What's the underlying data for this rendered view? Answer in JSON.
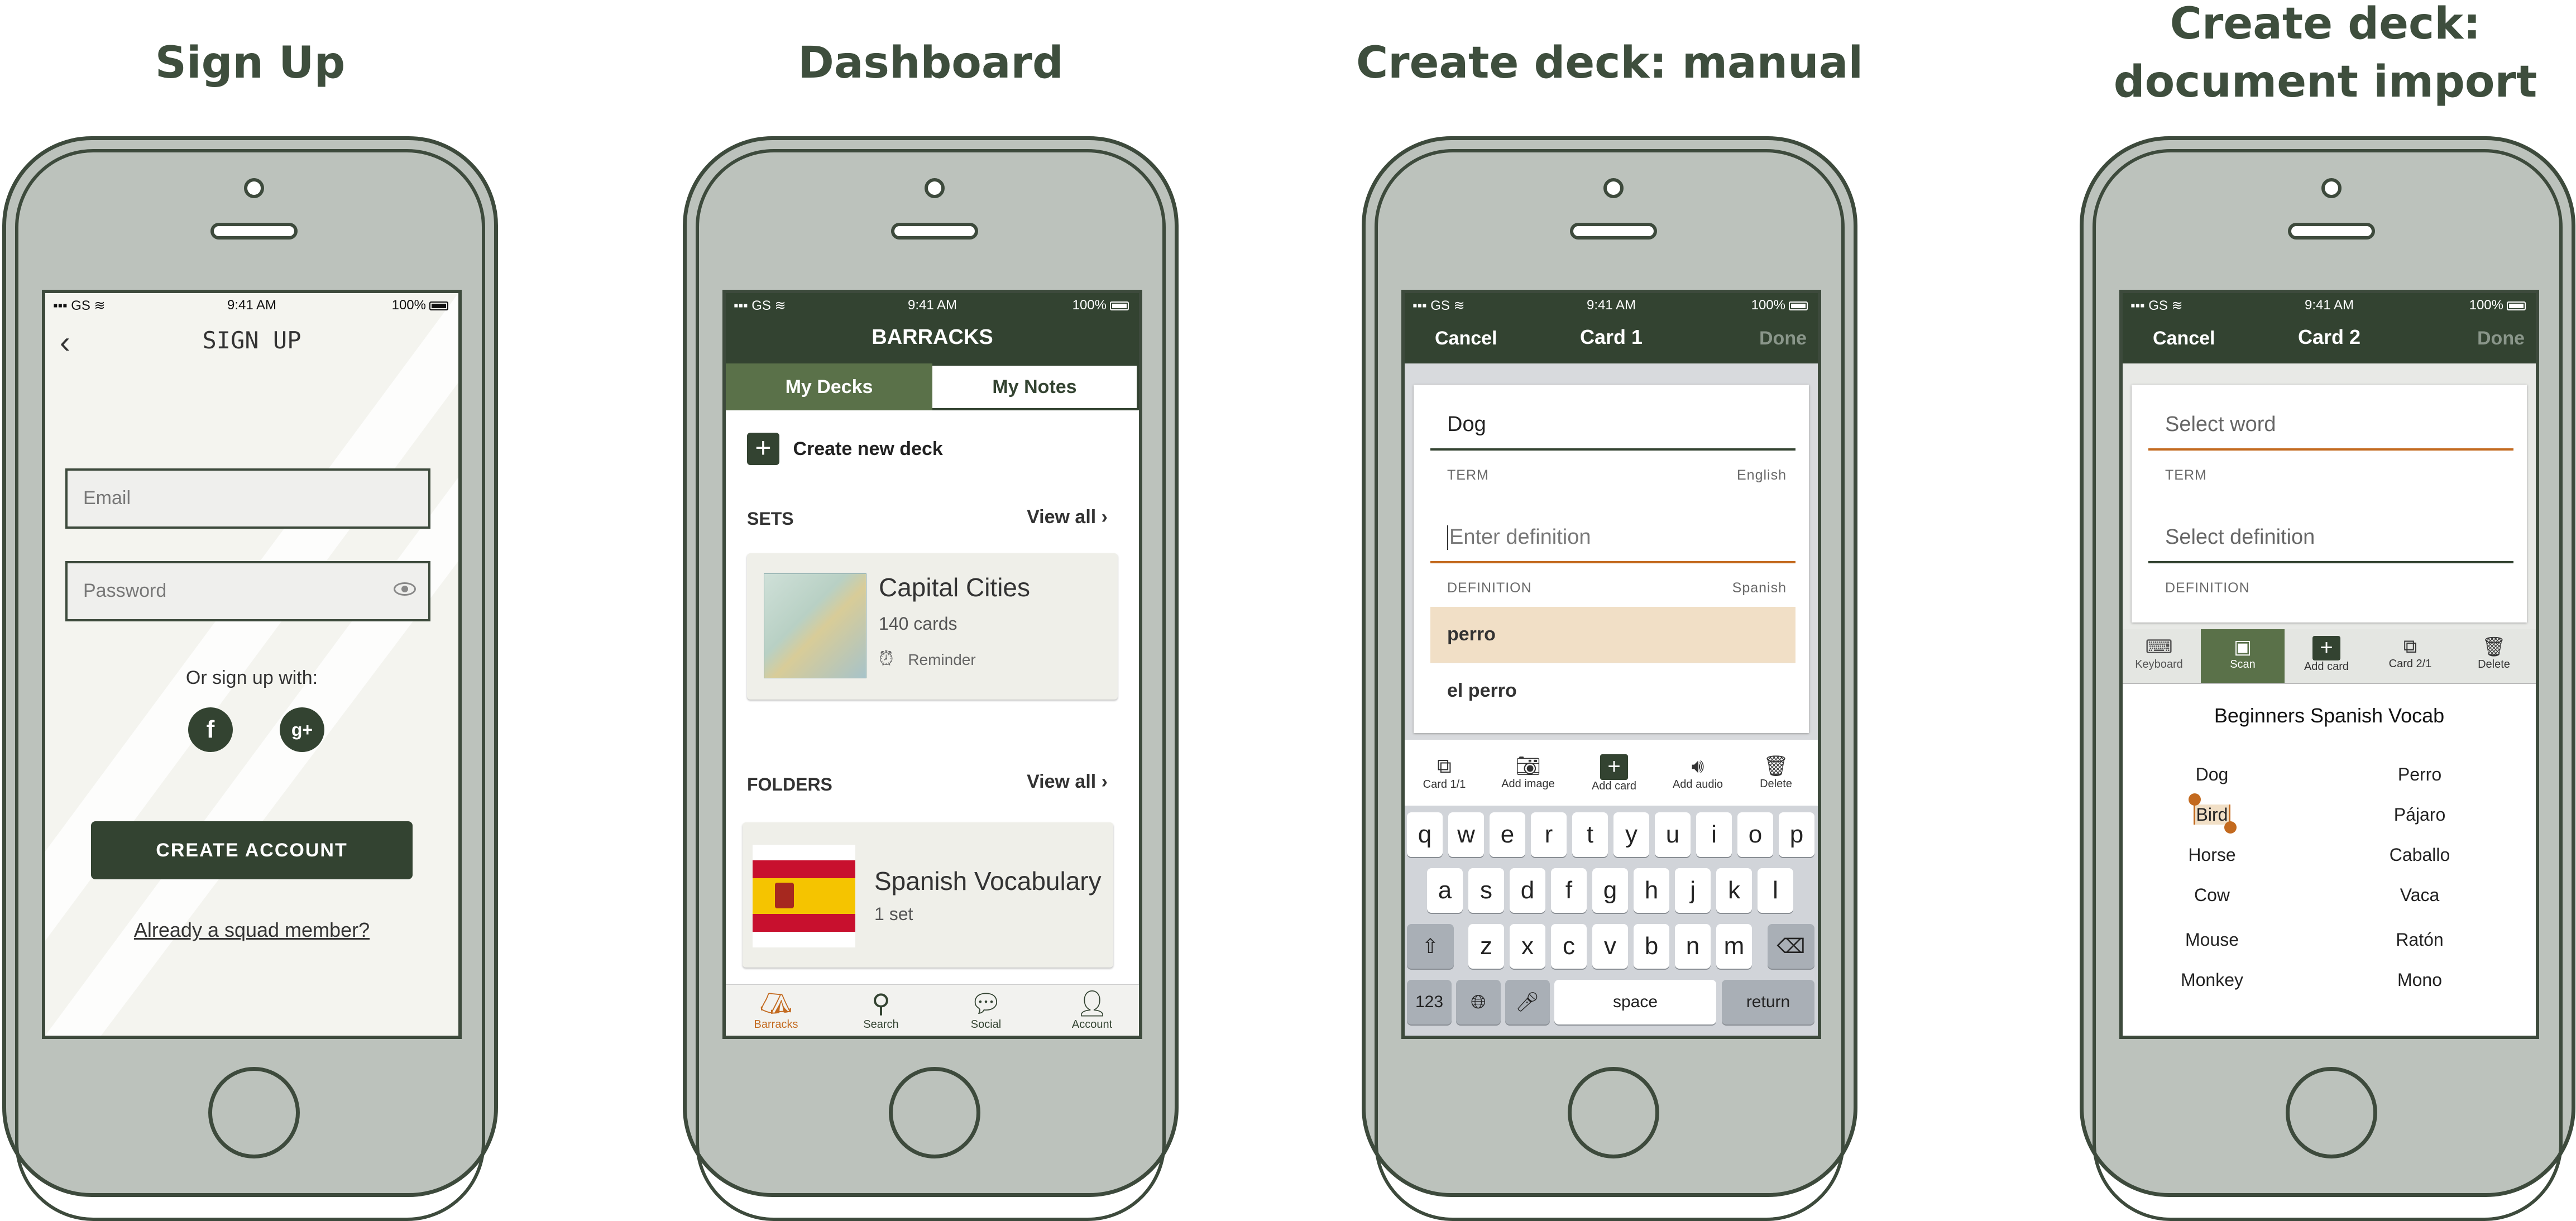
{
  "titles": {
    "signup": "Sign Up",
    "dashboard": "Dashboard",
    "manual": "Create deck: manual",
    "import_line1": "Create deck:",
    "import_line2": "document import"
  },
  "status": {
    "carrier": "GS",
    "time": "9:41 AM",
    "battery": "100%"
  },
  "signup": {
    "title": "SIGN UP",
    "email_placeholder": "Email",
    "password_placeholder": "Password",
    "or_label": "Or sign up with:",
    "facebook": "f",
    "google": "g+",
    "create_button": "CREATE ACCOUNT",
    "already_link": "Already a squad member?"
  },
  "dashboard": {
    "app_title": "BARRACKS",
    "tabs": [
      "My Decks",
      "My Notes"
    ],
    "create_deck": "Create new deck",
    "sets_header": "SETS",
    "view_all": "View all",
    "set_card": {
      "title": "Capital Cities",
      "count": "140 cards",
      "reminder": "Reminder"
    },
    "folders_header": "FOLDERS",
    "folder_card": {
      "title": "Spanish Vocabulary",
      "count": "1 set"
    },
    "bottom_nav": [
      "Barracks",
      "Search",
      "Social",
      "Account"
    ]
  },
  "manual": {
    "cancel": "Cancel",
    "title": "Card 1",
    "done": "Done",
    "term_value": "Dog",
    "term_label": "TERM",
    "term_lang": "English",
    "def_placeholder": "Enter definition",
    "def_label": "DEFINITION",
    "def_lang": "Spanish",
    "suggestions": [
      "perro",
      "el perro"
    ],
    "toolbar": [
      "Card 1/1",
      "Add image",
      "Add card",
      "Add audio",
      "Delete"
    ],
    "keyboard": {
      "row1": [
        "q",
        "w",
        "e",
        "r",
        "t",
        "y",
        "u",
        "i",
        "o",
        "p"
      ],
      "row2": [
        "a",
        "s",
        "d",
        "f",
        "g",
        "h",
        "j",
        "k",
        "l"
      ],
      "row3": [
        "z",
        "x",
        "c",
        "v",
        "b",
        "n",
        "m"
      ],
      "num": "123",
      "space": "space",
      "return": "return"
    }
  },
  "import": {
    "cancel": "Cancel",
    "title": "Card 2",
    "done": "Done",
    "term_placeholder": "Select word",
    "term_label": "TERM",
    "def_placeholder": "Select definition",
    "def_label": "DEFINITION",
    "toolbar": [
      "Keyboard",
      "Scan",
      "Add card",
      "Card 2/1",
      "Delete"
    ],
    "doc_title": "Beginners Spanish Vocab",
    "words_en": [
      "Dog",
      "Bird",
      "Horse",
      "Cow",
      "Mouse",
      "Monkey"
    ],
    "words_es": [
      "Perro",
      "Pájaro",
      "Caballo",
      "Vaca",
      "Ratón",
      "Mono"
    ]
  },
  "colors": {
    "dark_green": "#334331",
    "mid_green": "#5a7149",
    "accent_orange": "#c36a1f",
    "highlight": "#f1dfc6"
  }
}
